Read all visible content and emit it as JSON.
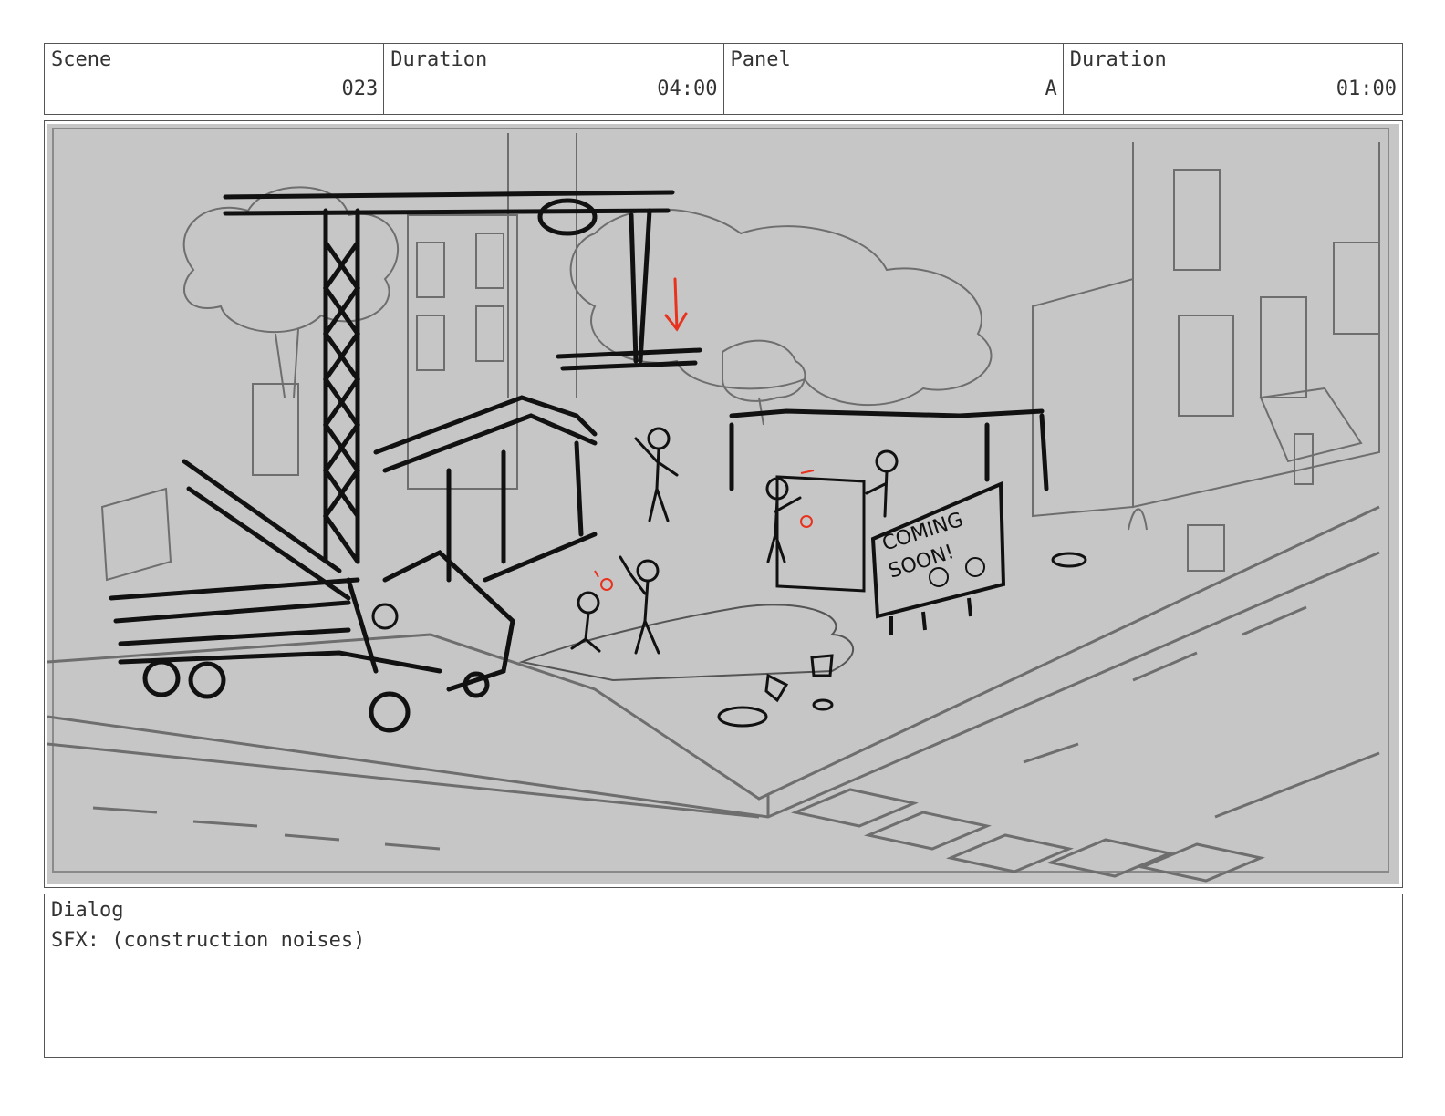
{
  "header": {
    "scene_label": "Scene",
    "scene_value": "023",
    "duration_label": "Duration",
    "duration_value": "04:00",
    "panel_label": "Panel",
    "panel_value": "A",
    "panel_duration_label": "Duration",
    "panel_duration_value": "01:00"
  },
  "panel": {
    "sign_line1": "COMING",
    "sign_line2": "SOON!"
  },
  "dialog": {
    "label": "Dialog",
    "text": "SFX: (construction noises)"
  },
  "colors": {
    "sketch_bg": "#c6c6c6",
    "ink": "#111111",
    "pencil": "#6e6e6e",
    "accent": "#e8321e"
  }
}
